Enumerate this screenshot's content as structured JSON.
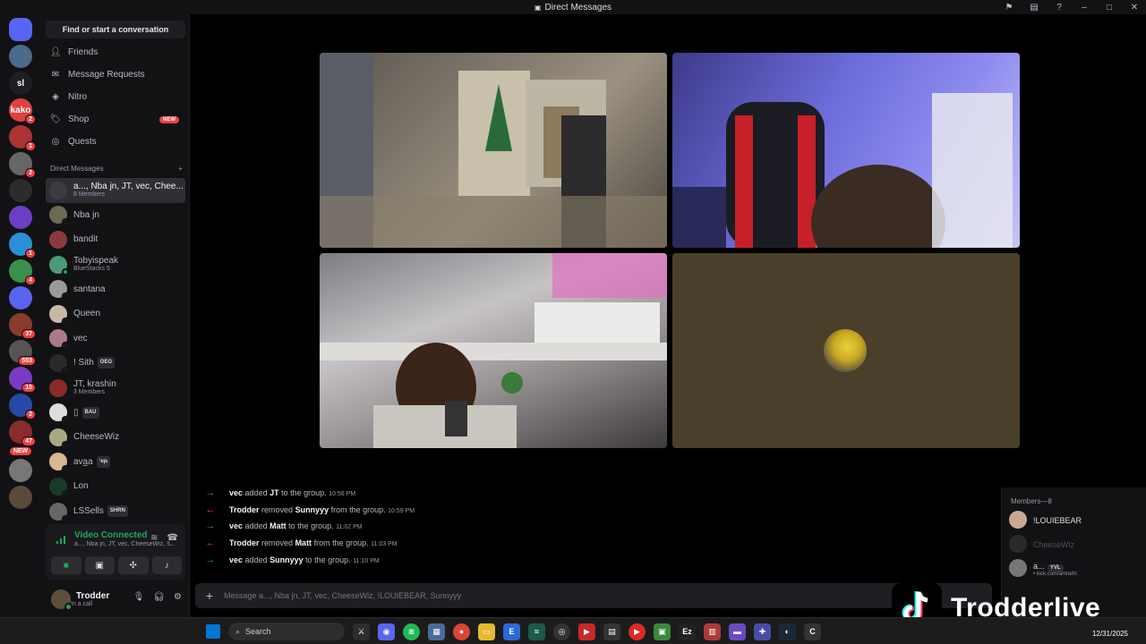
{
  "window": {
    "title": "Direct Messages"
  },
  "servers": [
    {
      "label": "",
      "color": "#5865f2",
      "badge": ""
    },
    {
      "label": "",
      "color": "#4b6a8c",
      "badge": ""
    },
    {
      "label": "sl",
      "color": "#1e1f22",
      "badge": ""
    },
    {
      "label": "kako",
      "color": "#e04040",
      "badge": "2"
    },
    {
      "label": "",
      "color": "#a33",
      "badge": "1"
    },
    {
      "label": "",
      "color": "#666",
      "badge": "2"
    },
    {
      "label": "",
      "color": "#2c2c2c",
      "badge": ""
    },
    {
      "label": "",
      "color": "#6a3fc4",
      "badge": ""
    },
    {
      "label": "",
      "color": "#2a8fd6",
      "badge": "1"
    },
    {
      "label": "",
      "color": "#3a8f4c",
      "badge": "4"
    },
    {
      "label": "",
      "color": "#5865f2",
      "badge": ""
    },
    {
      "label": "",
      "color": "#8a3c2c",
      "badge": "37"
    },
    {
      "label": "",
      "color": "#555",
      "badge": "503"
    },
    {
      "label": "",
      "color": "#7a3ac4",
      "badge": "10"
    },
    {
      "label": "",
      "color": "#2848a8",
      "badge": "2"
    },
    {
      "label": "",
      "color": "#8a2c2c",
      "badge": "47"
    },
    {
      "label": "",
      "color": "#777",
      "badge": ""
    },
    {
      "label": "",
      "color": "#5a4a3a",
      "badge": ""
    }
  ],
  "servers_new_label": "NEW",
  "sidebar": {
    "search_label": "Find or start a conversation",
    "nav": [
      {
        "label": "Friends",
        "icon": "friends-icon"
      },
      {
        "label": "Message Requests",
        "icon": "envelope-icon"
      },
      {
        "label": "Nitro",
        "icon": "nitro-icon"
      },
      {
        "label": "Shop",
        "icon": "shop-icon",
        "badge": "NEW"
      },
      {
        "label": "Quests",
        "icon": "quests-icon"
      }
    ],
    "dm_header": "Direct Messages",
    "dm_add": "+",
    "dms": [
      {
        "name": "a..., Nba jn, JT, vec, Chee...",
        "sub": "8 Members",
        "color": "#3a3c42",
        "active": true,
        "status": ""
      },
      {
        "name": "Nba jn",
        "sub": "",
        "color": "#6d6a52",
        "status": "off"
      },
      {
        "name": "bandit",
        "sub": "",
        "color": "#8a3a3a",
        "status": ""
      },
      {
        "name": "Tobyispeak",
        "sub": "BlueStacks 5",
        "color": "#4a9a7a",
        "status": "on"
      },
      {
        "name": "santana",
        "sub": "",
        "color": "#9a9a9a",
        "status": "off"
      },
      {
        "name": "Queen",
        "sub": "",
        "color": "#c8b8a8",
        "status": "off"
      },
      {
        "name": "vec",
        "sub": "",
        "color": "#aa7a8a",
        "status": "off"
      },
      {
        "name": "! Sith",
        "tag": "OEG",
        "sub": "",
        "color": "#2a2a2a",
        "status": "off"
      },
      {
        "name": "JT, krashin",
        "sub": "3 Members",
        "color": "#8a2a2a",
        "status": ""
      },
      {
        "name": "▯",
        "tag": "BAU",
        "sub": "",
        "color": "#ddd",
        "status": "off"
      },
      {
        "name": "CheeseWiz",
        "sub": "",
        "color": "#aaa884",
        "status": "off"
      },
      {
        "name": "ava̲a",
        "tag": "ʻepᵢ",
        "sub": "",
        "color": "#d8b890",
        "status": "off"
      },
      {
        "name": "Lon",
        "sub": "",
        "color": "#1a3a2a",
        "status": "off"
      },
      {
        "name": "LSSells",
        "tag": "SHRN",
        "sub": "",
        "color": "#666",
        "status": "off"
      }
    ]
  },
  "voice": {
    "status": "Video Connected",
    "channel": "a..., Nba jn, JT, vec, CheeseWiz, !L..."
  },
  "user": {
    "name": "Trodder",
    "status": "In a call"
  },
  "log": [
    {
      "dir": "in",
      "actor": "vec",
      "verb": "added",
      "target": "JT",
      "rest": "to the group.",
      "time": "10:56 PM"
    },
    {
      "dir": "out",
      "actor": "Trodder",
      "verb": "removed",
      "target": "Sunnyyy",
      "rest": "from the group.",
      "time": "10:59 PM"
    },
    {
      "dir": "in",
      "actor": "vec",
      "verb": "added",
      "target": "Matt",
      "rest": "to the group.",
      "time": "11:02 PM"
    },
    {
      "dir": "out",
      "actor": "Trodder",
      "verb": "removed",
      "target": "Matt",
      "rest": "from the group.",
      "time": "11:03 PM"
    },
    {
      "dir": "in",
      "actor": "vec",
      "verb": "added",
      "target": "Sunnyyy",
      "rest": "to the group.",
      "time": "11:10 PM"
    }
  ],
  "composer": {
    "placeholder": "Message a..., Nba jn, JT, vec, CheeseWiz, !LOUIEBEAR, Sunnyyy"
  },
  "members": {
    "header": "Members—8",
    "list": [
      {
        "name": "!LOUIEBEAR",
        "sub": "",
        "color": "#c8a890",
        "dim": false
      },
      {
        "name": "CheeseWiz",
        "sub": "",
        "color": "#555",
        "dim": true
      },
      {
        "name": "a...",
        "tag": "YVL",
        "sub": "• kick.com/amirefn",
        "color": "#777",
        "dim": false
      }
    ]
  },
  "watermark": {
    "text": "Trodderlive"
  },
  "taskbar": {
    "search": "Search",
    "date": "12/31/2025"
  },
  "colors": {
    "brand": "#5865f2",
    "online": "#23a55a",
    "danger": "#f23f43"
  }
}
